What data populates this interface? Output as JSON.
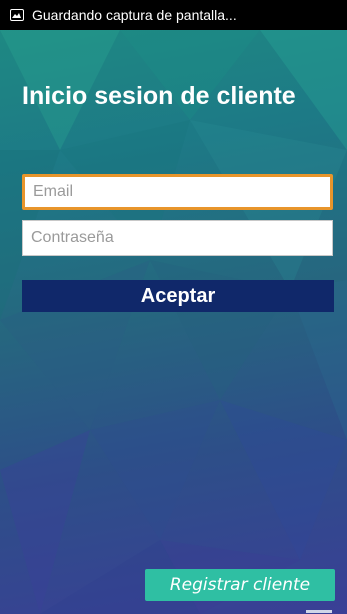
{
  "status_bar": {
    "icon": "screenshot-icon",
    "text": "Guardando captura de pantalla..."
  },
  "login": {
    "title": "Inicio sesion de cliente",
    "email_placeholder": "Email",
    "email_value": "",
    "password_placeholder": "Contraseña",
    "password_value": "",
    "accept_label": "Aceptar",
    "register_label": "Registrar cliente"
  },
  "colors": {
    "accept_button": "#10286a",
    "register_button": "#2fbfa3",
    "focus_border": "#e8952b",
    "status_bar": "#000000"
  }
}
